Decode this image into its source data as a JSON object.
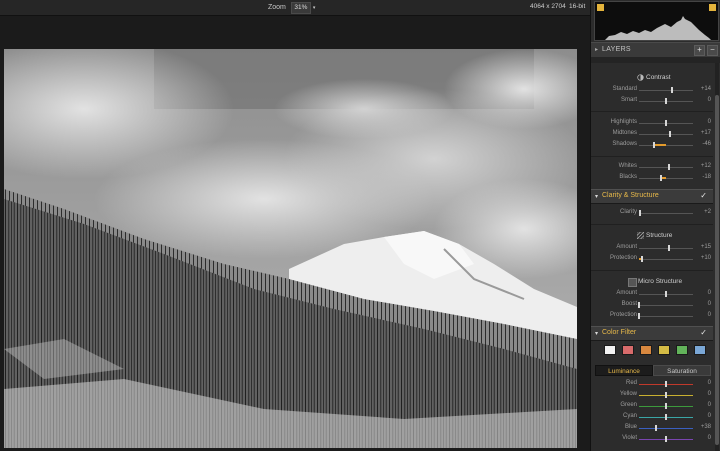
{
  "topbar": {
    "zoom_label": "Zoom",
    "zoom_value": "31%",
    "image_size": "4064 x 2704",
    "bit_depth": "16-bit"
  },
  "layers": {
    "label": "LAYERS",
    "add": "+",
    "remove": "−"
  },
  "contrast": {
    "title": "Contrast",
    "sliders": [
      {
        "label": "Standard",
        "value": "+14",
        "pos": 0.62
      },
      {
        "label": "Smart",
        "value": "0",
        "pos": 0.5
      }
    ]
  },
  "tones": {
    "sliders": [
      {
        "label": "Highlights",
        "value": "0",
        "pos": 0.5
      },
      {
        "label": "Midtones",
        "value": "+17",
        "pos": 0.58
      },
      {
        "label": "Shadows",
        "value": "-46",
        "pos": 0.27
      }
    ]
  },
  "whites_blacks": {
    "sliders": [
      {
        "label": "Whites",
        "value": "+12",
        "pos": 0.56
      },
      {
        "label": "Blacks",
        "value": "-18",
        "pos": 0.41
      }
    ]
  },
  "clarity_structure": {
    "title": "Clarity & Structure",
    "check": "✓",
    "clarity": {
      "label": "Clarity",
      "value": "+2",
      "pos": 0.02
    }
  },
  "structure": {
    "title": "Structure",
    "sliders": [
      {
        "label": "Amount",
        "value": "+15",
        "pos": 0.56
      },
      {
        "label": "Protection",
        "value": "+10",
        "pos": 0.05
      }
    ]
  },
  "micro_structure": {
    "title": "Micro Structure",
    "sliders": [
      {
        "label": "Amount",
        "value": "0",
        "pos": 0.5
      },
      {
        "label": "Boost",
        "value": "0",
        "pos": 0.0
      },
      {
        "label": "Protection",
        "value": "0",
        "pos": 0.0
      }
    ]
  },
  "color_filter": {
    "title": "Color Filter",
    "check": "✓",
    "swatches": [
      "#f2f2f2",
      "#d86b6b",
      "#d8883f",
      "#d4bb45",
      "#62b35a",
      "#7aa7d6"
    ],
    "tabs": {
      "luminance": "Luminance",
      "saturation": "Saturation"
    },
    "sliders": [
      {
        "label": "Red",
        "value": "0",
        "pos": 0.5,
        "color": "#c0392b"
      },
      {
        "label": "Yellow",
        "value": "0",
        "pos": 0.5,
        "color": "#c8b030"
      },
      {
        "label": "Green",
        "value": "0",
        "pos": 0.5,
        "color": "#3c9a3c"
      },
      {
        "label": "Cyan",
        "value": "0",
        "pos": 0.5,
        "color": "#3aa6a6"
      },
      {
        "label": "Blue",
        "value": "+38",
        "pos": 0.32,
        "color": "#3a5fc0"
      },
      {
        "label": "Violet",
        "value": "0",
        "pos": 0.5,
        "color": "#7a45b0"
      }
    ]
  },
  "colors": {
    "accent": "#e7b94a",
    "slider_fill": "#e39b2c",
    "panel_bg": "#2c2c2c"
  }
}
